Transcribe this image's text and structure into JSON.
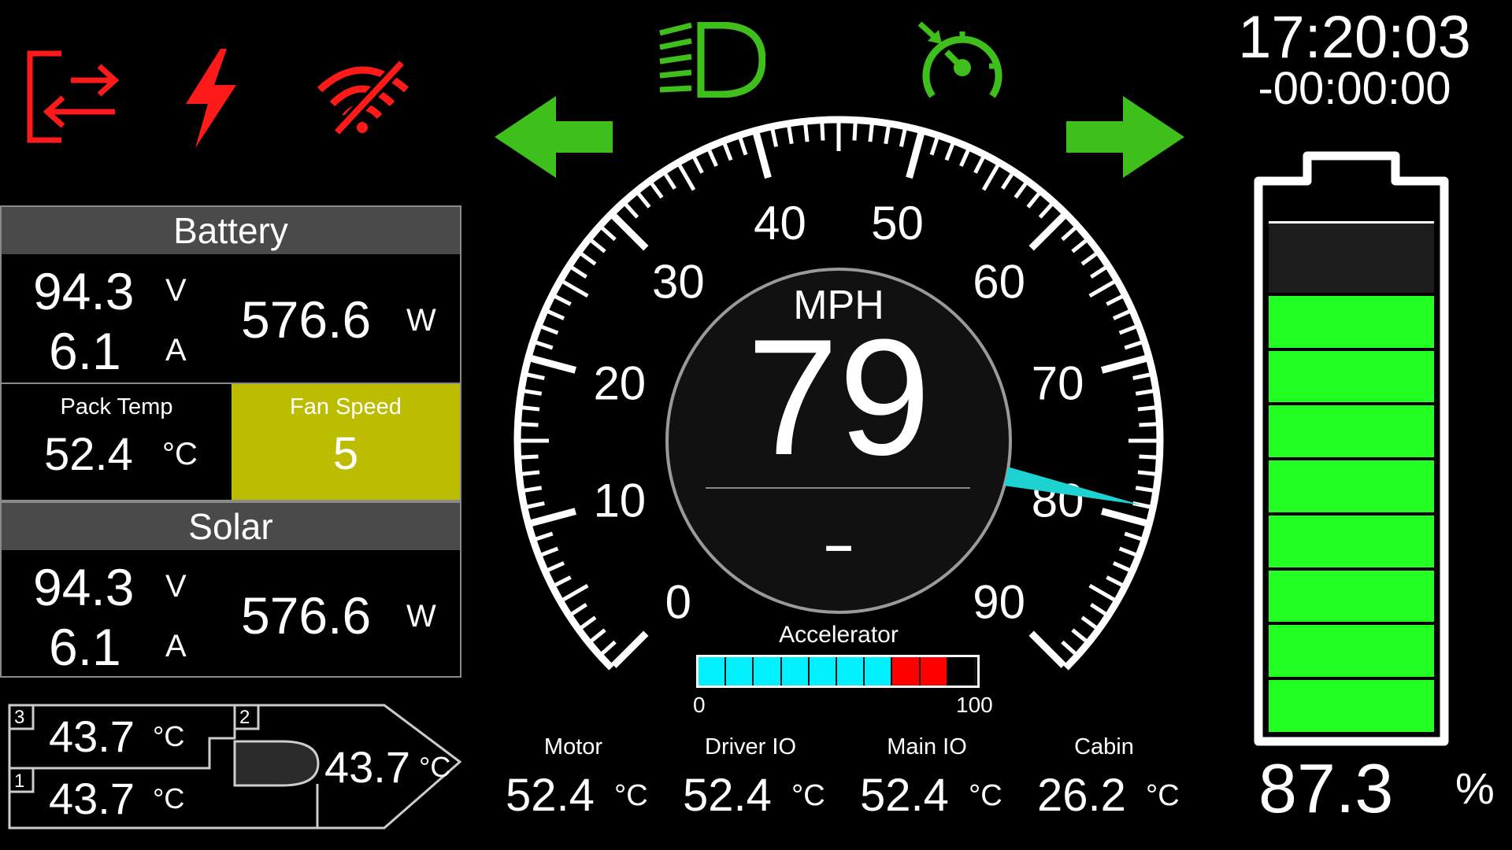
{
  "status_icons": [
    "exit-transfer-icon",
    "lightning-fault-icon",
    "wifi-off-icon"
  ],
  "indicator_icons": [
    "headlight-icon",
    "cruise-control-icon",
    "left-turn-arrow-icon",
    "right-turn-arrow-icon"
  ],
  "colors": {
    "alert_red": "#ff1a1a",
    "indicator_green": "#3fbf1c",
    "battery_green": "#22ff22",
    "fan_yellow": "#bcbc00",
    "needle_cyan": "#1ed2d2",
    "accel_cyan": "#00f0ff",
    "accel_red": "#ff0000"
  },
  "battery_panel": {
    "title": "Battery",
    "voltage": "94.3",
    "voltage_unit": "V",
    "current": "6.1",
    "current_unit": "A",
    "power": "576.6",
    "power_unit": "W",
    "pack_temp_label": "Pack Temp",
    "pack_temp": "52.4",
    "pack_temp_unit": "°C",
    "fan_speed_label": "Fan Speed",
    "fan_speed": "5"
  },
  "solar_panel": {
    "title": "Solar",
    "voltage": "94.3",
    "voltage_unit": "V",
    "current": "6.1",
    "current_unit": "A",
    "power": "576.6",
    "power_unit": "W"
  },
  "zones": {
    "zone3": {
      "id": "3",
      "temp": "43.7",
      "unit": "°C"
    },
    "zone1": {
      "id": "1",
      "temp": "43.7",
      "unit": "°C"
    },
    "zone2": {
      "id": "2",
      "temp": "43.7",
      "unit": "°C"
    }
  },
  "speedometer": {
    "unit": "MPH",
    "speed": "79",
    "gear": "–",
    "scale_min": 0,
    "scale_max": 90,
    "needle_value": 79,
    "ticks": [
      "0",
      "10",
      "20",
      "30",
      "40",
      "50",
      "60",
      "70",
      "80",
      "90"
    ]
  },
  "accelerator": {
    "label": "Accelerator",
    "min_label": "0",
    "max_label": "100",
    "cyan_fraction": 0.7,
    "red_fraction": 0.2
  },
  "temps": [
    {
      "label": "Motor",
      "value": "52.4",
      "unit": "°C"
    },
    {
      "label": "Driver IO",
      "value": "52.4",
      "unit": "°C"
    },
    {
      "label": "Main IO",
      "value": "52.4",
      "unit": "°C"
    },
    {
      "label": "Cabin",
      "value": "26.2",
      "unit": "°C"
    }
  ],
  "clock": {
    "time": "17:20:03",
    "elapsed": "-00:00:00"
  },
  "battery_level": {
    "percent": "87.3",
    "unit": "%",
    "fraction": 0.873
  }
}
